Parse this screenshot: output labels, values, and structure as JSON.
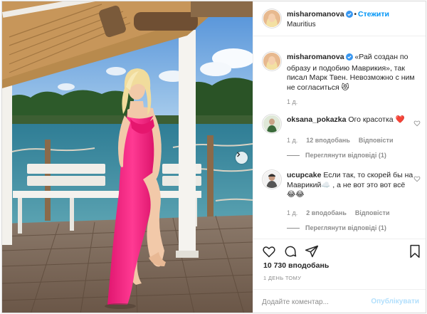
{
  "post": {
    "author": "misharomanova",
    "follow_label": "Стежити",
    "dot": "•",
    "location": "Mauritius",
    "caption": {
      "username": "misharomanova",
      "text": "«Рай создан по образу и подобию Маврикия», так писал Марк Твен. Невозможно с ним не согласиться 😻",
      "time": "1 д."
    },
    "comments": [
      {
        "username": "oksana_pokazka",
        "text": "Ого красотка ❤️",
        "time": "1 д.",
        "likes": "12 вподобань",
        "reply_label": "Відповісти",
        "view_replies": "Переглянути відповіді (1)"
      },
      {
        "username": "ucupcake",
        "text": "Если так, то скорей бы на Маврикий☁️ , а не вот это вот всё😂😂",
        "time": "1 д.",
        "likes": "2 вподобань",
        "reply_label": "Відповісти",
        "view_replies": "Переглянути відповіді (1)"
      }
    ],
    "likes_count": "10 730 вподобань",
    "posted_when": "1 ДЕНЬ ТОМУ",
    "comment_placeholder": "Додайте коментар...",
    "publish_label": "Опублікувати"
  },
  "icons": {
    "verified": "verified-badge-icon",
    "heart": "heart-icon",
    "comment": "comment-icon",
    "share": "share-icon",
    "save": "bookmark-icon",
    "next": "chevron-right-icon"
  },
  "colors": {
    "accent": "#0095f6",
    "muted": "#8e8e8e",
    "publish_disabled": "#b2dffc",
    "dress": "#f01b7a"
  }
}
